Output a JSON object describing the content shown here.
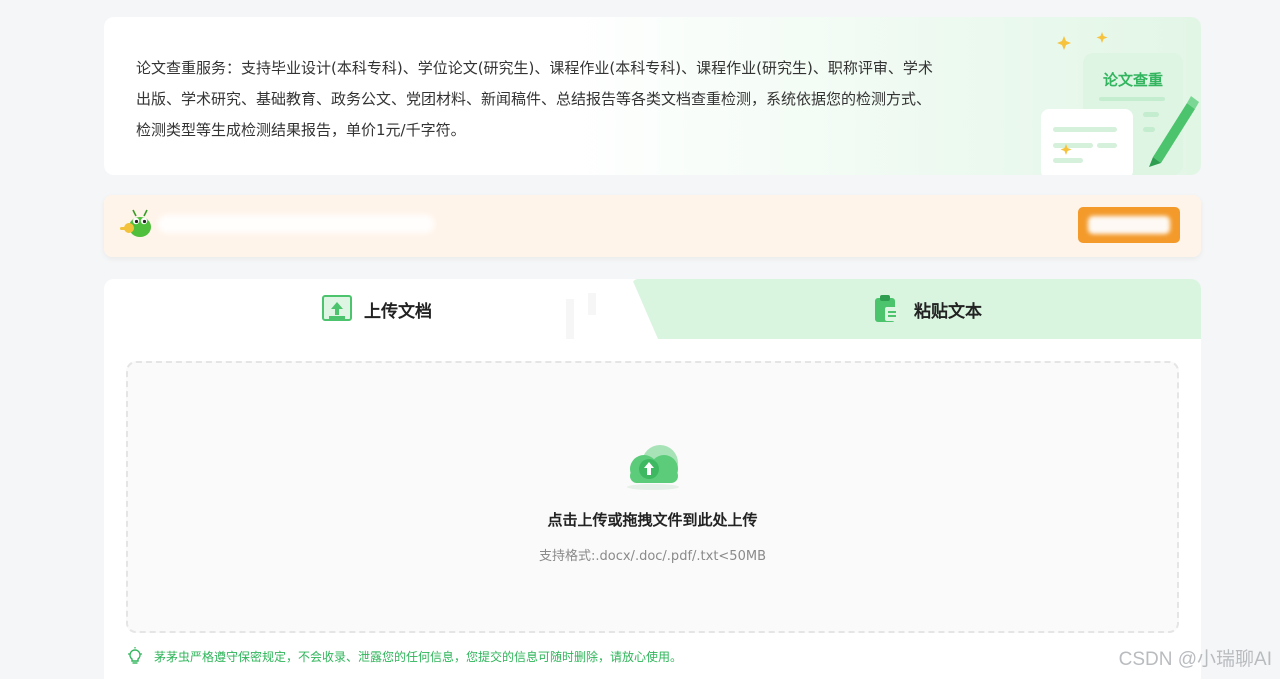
{
  "intro": {
    "text": "论文查重服务：支持毕业设计(本科专科)、学位论文(研究生)、课程作业(本科专科)、课程作业(研究生)、职称评审、学术出版、学术研究、基础教育、政务公文、党团材料、新闻稿件、总结报告等各类文档查重检测，系统依据您的检测方式、检测类型等生成检测结果报告，单价1元/千字符。",
    "illustration_label": "论文查重"
  },
  "tabs": {
    "upload": {
      "label": "上传文档",
      "icon": "upload-doc-icon"
    },
    "paste": {
      "label": "粘贴文本",
      "icon": "clipboard-icon"
    }
  },
  "dropzone": {
    "title": "点击上传或拖拽文件到此处上传",
    "formats": "支持格式:.docx/.doc/.pdf/.txt<50MB"
  },
  "privacy_note": "茅茅虫严格遵守保密规定，不会收录、泄露您的任何信息，您提交的信息可随时删除，请放心使用。",
  "watermark": "CSDN @小瑞聊AI",
  "colors": {
    "brand_green": "#2fb55a",
    "tab_inactive_bg": "#d9f5df",
    "banner_bg": "#fff4ea",
    "banner_button": "#f39a2b"
  }
}
